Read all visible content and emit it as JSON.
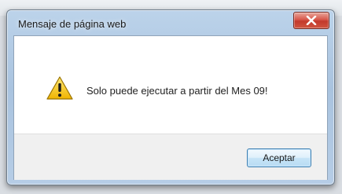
{
  "dialog": {
    "title": "Mensaje de página web",
    "message": "Solo puede ejecutar a partir del Mes 09!",
    "ok_label": "Aceptar"
  },
  "icons": {
    "close": "close-icon",
    "message": "warning-icon"
  },
  "colors": {
    "close_button": "#d0493b",
    "ok_button_border": "#3c7fb1",
    "warning_fill": "#f5c400"
  }
}
